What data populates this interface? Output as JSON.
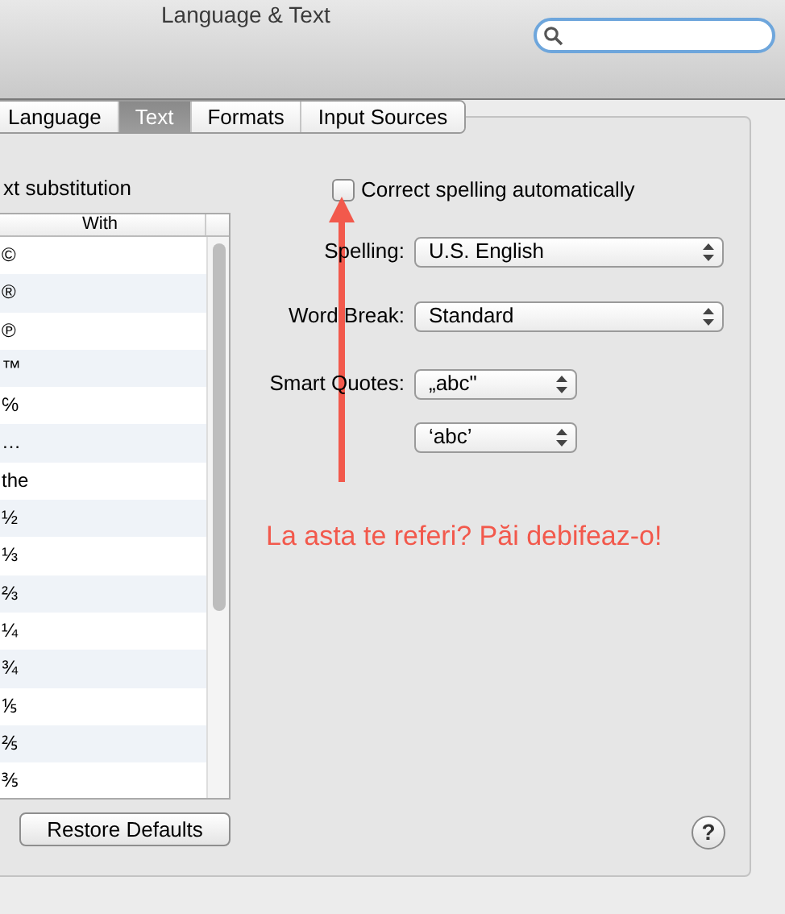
{
  "window": {
    "title": "Language & Text"
  },
  "tabs": [
    {
      "label": "Language",
      "selected": false
    },
    {
      "label": "Text",
      "selected": true
    },
    {
      "label": "Formats",
      "selected": false
    },
    {
      "label": "Input Sources",
      "selected": false
    }
  ],
  "substitution": {
    "heading": "xt substitution",
    "column": "With",
    "rows": [
      "©",
      "®",
      "℗",
      "™",
      "℅",
      "…",
      "the",
      "½",
      "⅓",
      "⅔",
      "¼",
      "¾",
      "⅕",
      "⅖",
      "⅗"
    ],
    "restore_button": "Restore Defaults"
  },
  "correct_spelling": {
    "label": "Correct spelling automatically",
    "checked": false
  },
  "settings": [
    {
      "label": "Spelling:",
      "value": "U.S. English",
      "kind": "wide"
    },
    {
      "label": "Word Break:",
      "value": "Standard",
      "kind": "wide"
    },
    {
      "label": "Smart Quotes:",
      "value": "„abc\"",
      "kind": "narrow"
    },
    {
      "value": "‘abc’",
      "kind": "narrow"
    }
  ],
  "annotation": {
    "text": "La asta te referi? Păi debifeaz-o!"
  },
  "help_button": "?"
}
